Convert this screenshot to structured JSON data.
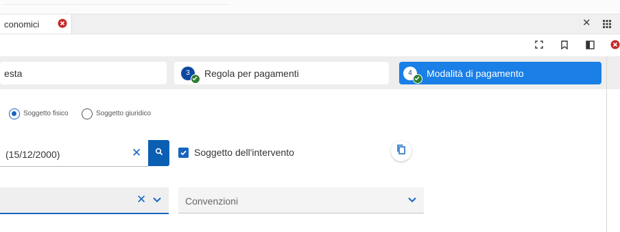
{
  "tab": {
    "title": "conomici"
  },
  "window": {
    "close_glyph": "✕"
  },
  "toolbar": {
    "icons": [
      "fullscreen-icon",
      "bookmark-icon",
      "split-view-icon",
      "close-circle-icon"
    ]
  },
  "stepper": {
    "steps": [
      {
        "label": "esta",
        "number": "",
        "state": "completed"
      },
      {
        "label": "Regola per pagamenti",
        "number": "3",
        "state": "completed"
      },
      {
        "label": "Modalità di pagamento",
        "number": "4",
        "state": "active"
      }
    ]
  },
  "subject_type": {
    "options": [
      "Soggetto fisico",
      "Soggetto giuridico"
    ],
    "selected": "Soggetto fisico"
  },
  "search": {
    "value": "(15/12/2000)",
    "clear_glyph": "✕"
  },
  "checkbox": {
    "label": "Soggetto dell'intervento",
    "checked": true
  },
  "select_left": {
    "value": "",
    "clear_glyph": "✕"
  },
  "select_right": {
    "placeholder": "Convenzioni"
  },
  "colors": {
    "primary": "#1565c0",
    "active_step": "#1a7fe6",
    "check_green": "#2e7d32",
    "close_red": "#c62828"
  }
}
